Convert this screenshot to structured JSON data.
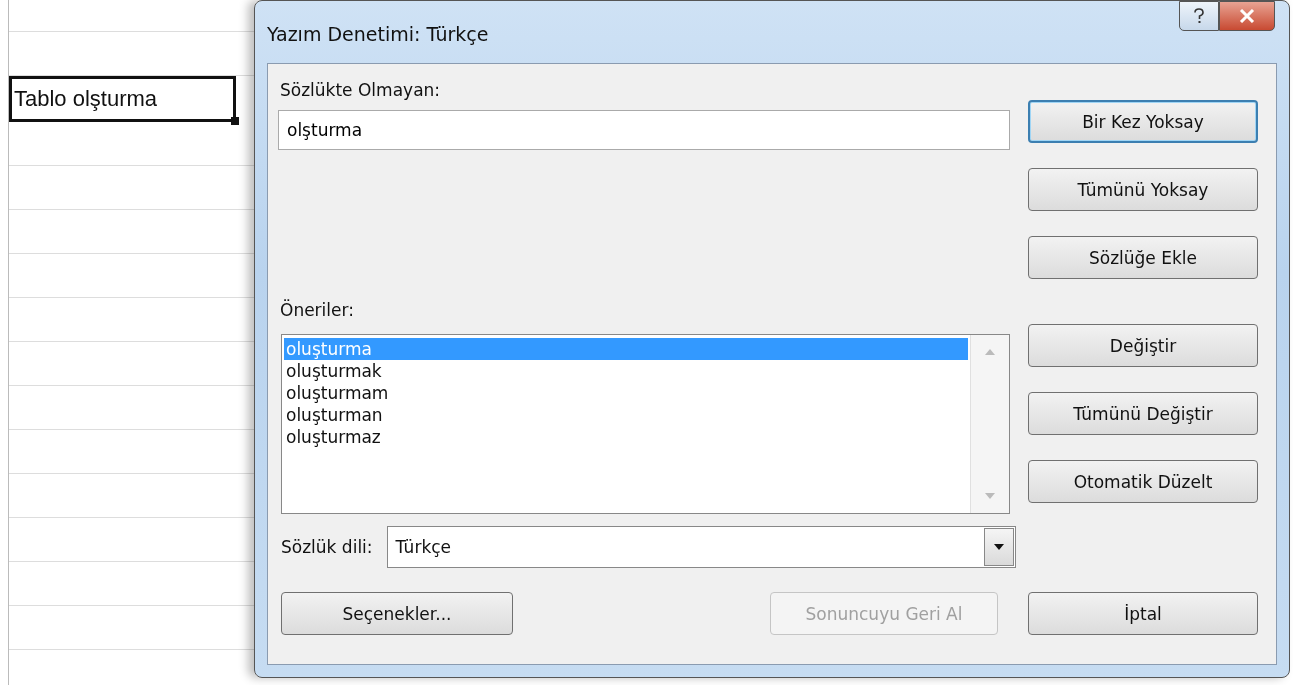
{
  "sheet": {
    "selected_cell": "Tablo olşturma"
  },
  "dialog": {
    "title": "Yazım Denetimi: Türkçe",
    "not_in_dictionary": {
      "label": "Sözlükte Olmayan:",
      "value": "olşturma"
    },
    "ignore_buttons": [
      {
        "label": "Bir Kez Yoksay",
        "default": true
      },
      {
        "label": "Tümünü Yoksay",
        "default": false
      },
      {
        "label": "Sözlüğe Ekle",
        "default": false
      }
    ],
    "suggestions": {
      "label": "Öneriler:",
      "items": [
        {
          "text": "oluşturma",
          "selected": true
        },
        {
          "text": "oluşturmak",
          "selected": false
        },
        {
          "text": "oluşturmam",
          "selected": false
        },
        {
          "text": "oluşturman",
          "selected": false
        },
        {
          "text": "oluşturmaz",
          "selected": false
        }
      ]
    },
    "change_buttons": [
      {
        "label": "Değiştir",
        "default": false
      },
      {
        "label": "Tümünü Değiştir",
        "default": false
      },
      {
        "label": "Otomatik Düzelt",
        "default": false
      }
    ],
    "dictionary_language": {
      "label": "Sözlük dili:",
      "value": "Türkçe"
    },
    "bottom_buttons": [
      {
        "label": "Seçenekler...",
        "disabled": false
      },
      {
        "label": "Sonuncuyu Geri Al",
        "disabled": true
      },
      {
        "label": "İptal",
        "disabled": false
      }
    ]
  }
}
